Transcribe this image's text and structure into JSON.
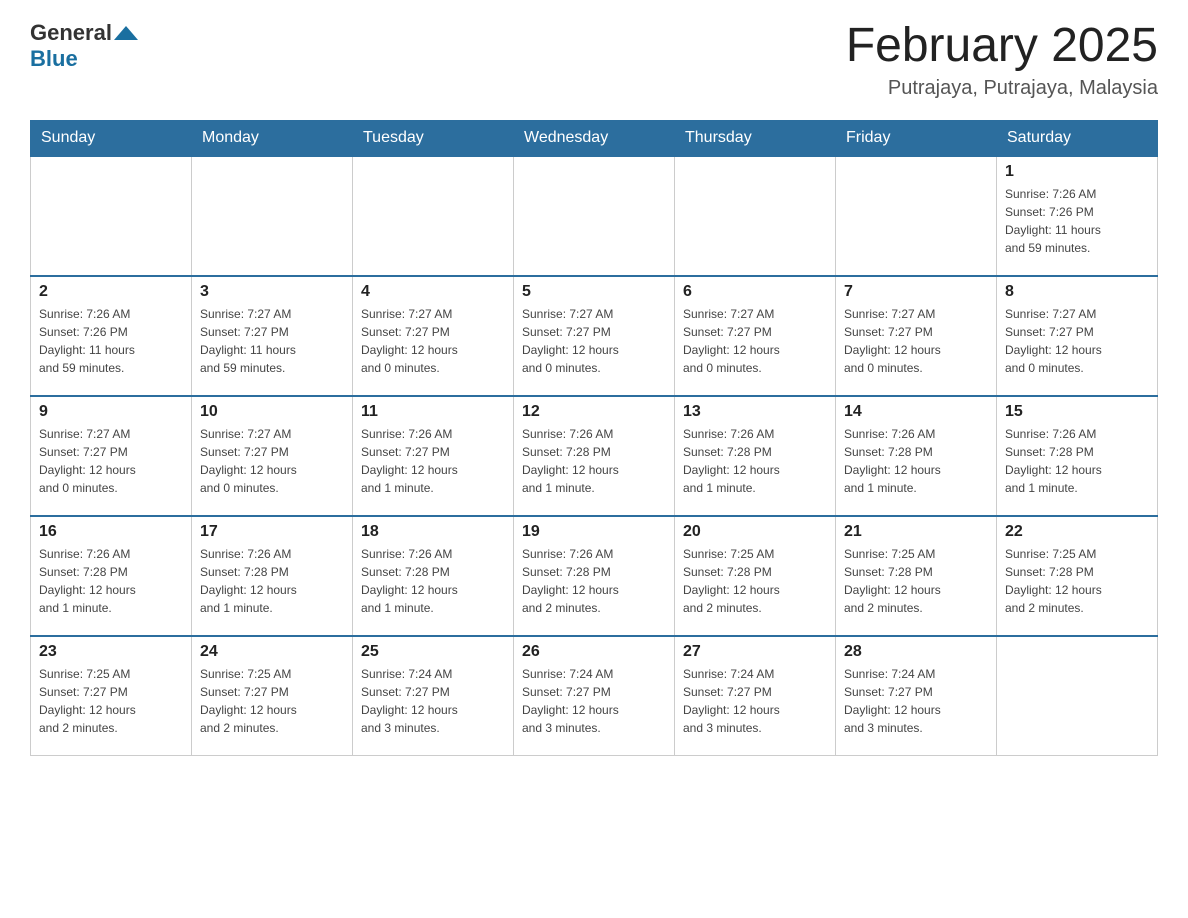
{
  "logo": {
    "general": "General",
    "blue": "Blue"
  },
  "title": "February 2025",
  "subtitle": "Putrajaya, Putrajaya, Malaysia",
  "days_of_week": [
    "Sunday",
    "Monday",
    "Tuesday",
    "Wednesday",
    "Thursday",
    "Friday",
    "Saturday"
  ],
  "weeks": [
    [
      {
        "day": "",
        "info": ""
      },
      {
        "day": "",
        "info": ""
      },
      {
        "day": "",
        "info": ""
      },
      {
        "day": "",
        "info": ""
      },
      {
        "day": "",
        "info": ""
      },
      {
        "day": "",
        "info": ""
      },
      {
        "day": "1",
        "info": "Sunrise: 7:26 AM\nSunset: 7:26 PM\nDaylight: 11 hours\nand 59 minutes."
      }
    ],
    [
      {
        "day": "2",
        "info": "Sunrise: 7:26 AM\nSunset: 7:26 PM\nDaylight: 11 hours\nand 59 minutes."
      },
      {
        "day": "3",
        "info": "Sunrise: 7:27 AM\nSunset: 7:27 PM\nDaylight: 11 hours\nand 59 minutes."
      },
      {
        "day": "4",
        "info": "Sunrise: 7:27 AM\nSunset: 7:27 PM\nDaylight: 12 hours\nand 0 minutes."
      },
      {
        "day": "5",
        "info": "Sunrise: 7:27 AM\nSunset: 7:27 PM\nDaylight: 12 hours\nand 0 minutes."
      },
      {
        "day": "6",
        "info": "Sunrise: 7:27 AM\nSunset: 7:27 PM\nDaylight: 12 hours\nand 0 minutes."
      },
      {
        "day": "7",
        "info": "Sunrise: 7:27 AM\nSunset: 7:27 PM\nDaylight: 12 hours\nand 0 minutes."
      },
      {
        "day": "8",
        "info": "Sunrise: 7:27 AM\nSunset: 7:27 PM\nDaylight: 12 hours\nand 0 minutes."
      }
    ],
    [
      {
        "day": "9",
        "info": "Sunrise: 7:27 AM\nSunset: 7:27 PM\nDaylight: 12 hours\nand 0 minutes."
      },
      {
        "day": "10",
        "info": "Sunrise: 7:27 AM\nSunset: 7:27 PM\nDaylight: 12 hours\nand 0 minutes."
      },
      {
        "day": "11",
        "info": "Sunrise: 7:26 AM\nSunset: 7:27 PM\nDaylight: 12 hours\nand 1 minute."
      },
      {
        "day": "12",
        "info": "Sunrise: 7:26 AM\nSunset: 7:28 PM\nDaylight: 12 hours\nand 1 minute."
      },
      {
        "day": "13",
        "info": "Sunrise: 7:26 AM\nSunset: 7:28 PM\nDaylight: 12 hours\nand 1 minute."
      },
      {
        "day": "14",
        "info": "Sunrise: 7:26 AM\nSunset: 7:28 PM\nDaylight: 12 hours\nand 1 minute."
      },
      {
        "day": "15",
        "info": "Sunrise: 7:26 AM\nSunset: 7:28 PM\nDaylight: 12 hours\nand 1 minute."
      }
    ],
    [
      {
        "day": "16",
        "info": "Sunrise: 7:26 AM\nSunset: 7:28 PM\nDaylight: 12 hours\nand 1 minute."
      },
      {
        "day": "17",
        "info": "Sunrise: 7:26 AM\nSunset: 7:28 PM\nDaylight: 12 hours\nand 1 minute."
      },
      {
        "day": "18",
        "info": "Sunrise: 7:26 AM\nSunset: 7:28 PM\nDaylight: 12 hours\nand 1 minute."
      },
      {
        "day": "19",
        "info": "Sunrise: 7:26 AM\nSunset: 7:28 PM\nDaylight: 12 hours\nand 2 minutes."
      },
      {
        "day": "20",
        "info": "Sunrise: 7:25 AM\nSunset: 7:28 PM\nDaylight: 12 hours\nand 2 minutes."
      },
      {
        "day": "21",
        "info": "Sunrise: 7:25 AM\nSunset: 7:28 PM\nDaylight: 12 hours\nand 2 minutes."
      },
      {
        "day": "22",
        "info": "Sunrise: 7:25 AM\nSunset: 7:28 PM\nDaylight: 12 hours\nand 2 minutes."
      }
    ],
    [
      {
        "day": "23",
        "info": "Sunrise: 7:25 AM\nSunset: 7:27 PM\nDaylight: 12 hours\nand 2 minutes."
      },
      {
        "day": "24",
        "info": "Sunrise: 7:25 AM\nSunset: 7:27 PM\nDaylight: 12 hours\nand 2 minutes."
      },
      {
        "day": "25",
        "info": "Sunrise: 7:24 AM\nSunset: 7:27 PM\nDaylight: 12 hours\nand 3 minutes."
      },
      {
        "day": "26",
        "info": "Sunrise: 7:24 AM\nSunset: 7:27 PM\nDaylight: 12 hours\nand 3 minutes."
      },
      {
        "day": "27",
        "info": "Sunrise: 7:24 AM\nSunset: 7:27 PM\nDaylight: 12 hours\nand 3 minutes."
      },
      {
        "day": "28",
        "info": "Sunrise: 7:24 AM\nSunset: 7:27 PM\nDaylight: 12 hours\nand 3 minutes."
      },
      {
        "day": "",
        "info": ""
      }
    ]
  ]
}
